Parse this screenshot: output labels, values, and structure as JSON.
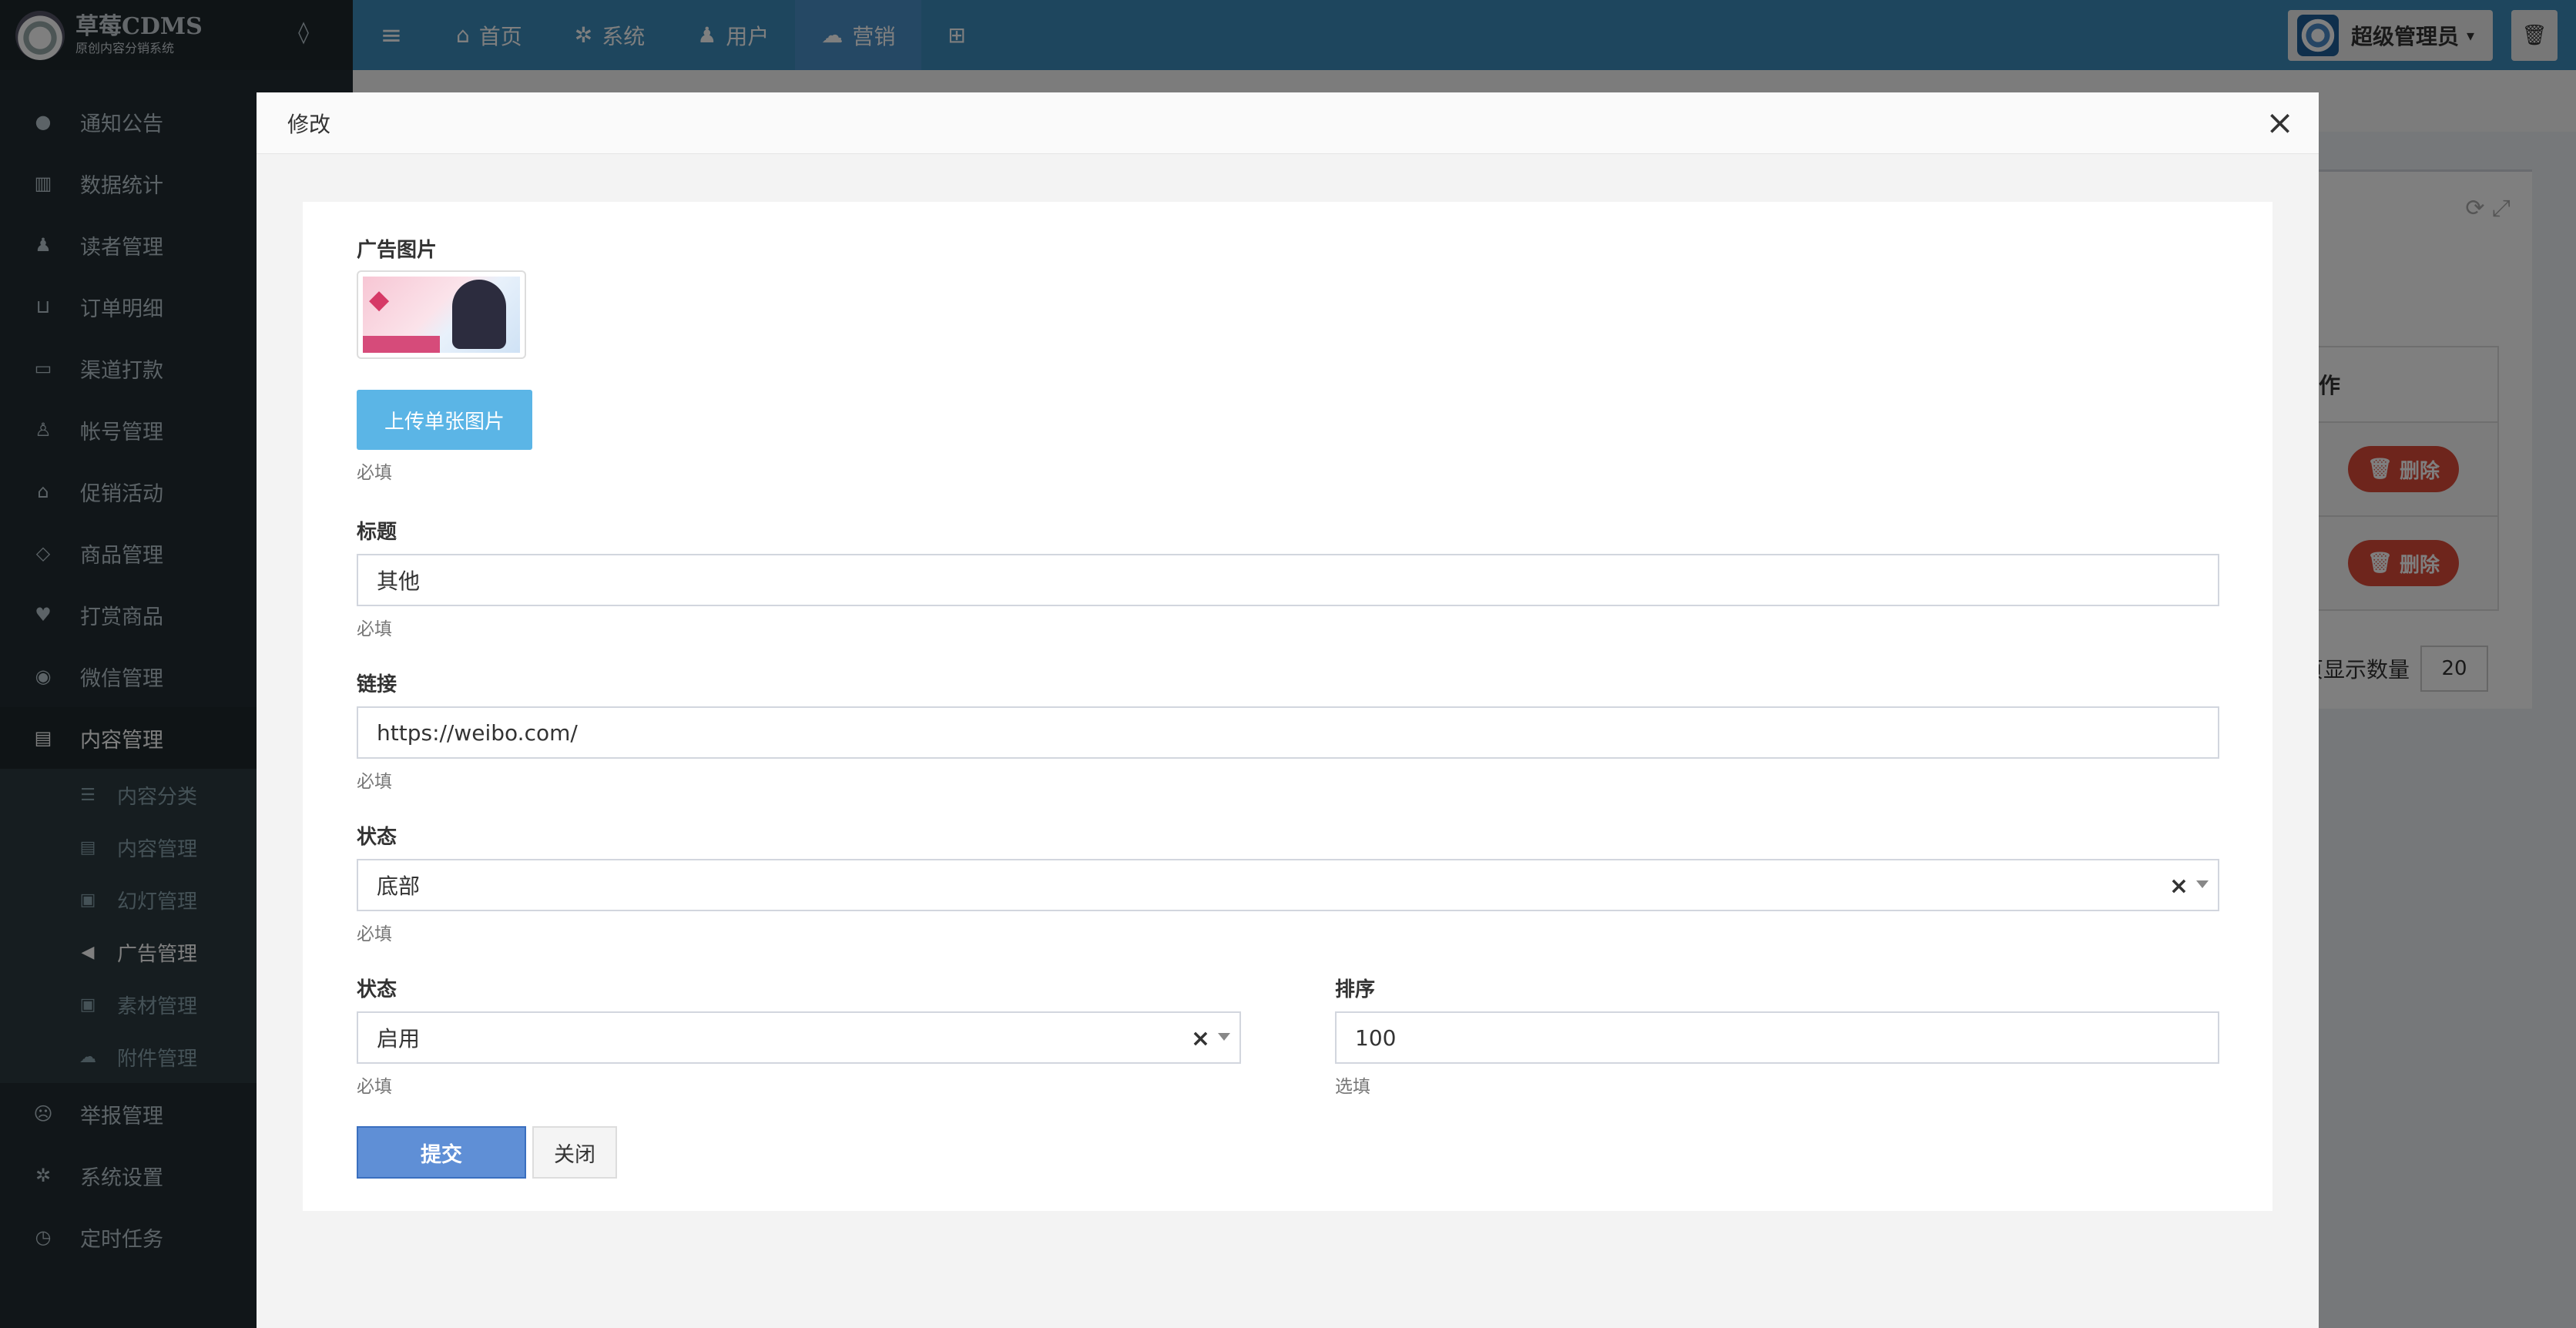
{
  "brand": {
    "title": "草莓CDMS",
    "subtitle": "原创内容分销系统"
  },
  "sidebar": {
    "items": [
      {
        "label": "通知公告",
        "icon": "comment-icon"
      },
      {
        "label": "数据统计",
        "icon": "bar-chart-icon"
      },
      {
        "label": "读者管理",
        "icon": "users-icon"
      },
      {
        "label": "订单明细",
        "icon": "cart-icon"
      },
      {
        "label": "渠道打款",
        "icon": "card-icon"
      },
      {
        "label": "帐号管理",
        "icon": "user-icon"
      },
      {
        "label": "促销活动",
        "icon": "bank-icon"
      },
      {
        "label": "商品管理",
        "icon": "diamond-icon"
      },
      {
        "label": "打赏商品",
        "icon": "heart-icon"
      },
      {
        "label": "微信管理",
        "icon": "wechat-icon"
      },
      {
        "label": "内容管理",
        "icon": "book-icon"
      }
    ],
    "subitems": [
      {
        "label": "内容分类",
        "icon": "list-icon"
      },
      {
        "label": "内容管理",
        "icon": "book-icon"
      },
      {
        "label": "幻灯管理",
        "icon": "image-icon"
      },
      {
        "label": "广告管理",
        "icon": "bullhorn-icon"
      },
      {
        "label": "素材管理",
        "icon": "image-icon"
      },
      {
        "label": "附件管理",
        "icon": "cloud-icon"
      }
    ],
    "items_after": [
      {
        "label": "举报管理",
        "icon": "frown-icon"
      },
      {
        "label": "系统设置",
        "icon": "gear-icon"
      },
      {
        "label": "定时任务",
        "icon": "clock-icon"
      }
    ]
  },
  "topnav": {
    "tabs": [
      {
        "label": "首页",
        "icon": "home-icon"
      },
      {
        "label": "系统",
        "icon": "gear-icon"
      },
      {
        "label": "用户",
        "icon": "user-icon"
      },
      {
        "label": "营销",
        "icon": "cloud-icon"
      }
    ],
    "user_name": "超级管理员"
  },
  "background": {
    "table_header": "操作",
    "delete_label": "删除",
    "page_size_label": "每页显示数量",
    "page_size_value": "20"
  },
  "modal": {
    "title": "修改",
    "image_label": "广告图片",
    "upload_label": "上传单张图片",
    "upload_help": "必填",
    "title_label": "标题",
    "title_value": "其他",
    "title_help": "必填",
    "link_label": "链接",
    "link_value": "https://weibo.com/",
    "link_help": "必填",
    "position_label": "状态",
    "position_value": "底部",
    "position_help": "必填",
    "status_label": "状态",
    "status_value": "启用",
    "status_help": "必填",
    "sort_label": "排序",
    "sort_value": "100",
    "sort_help": "选填",
    "submit_label": "提交",
    "close_label": "关闭"
  },
  "colors": {
    "sidebar_bg": "#222d32",
    "topnav_bg": "#3c8dbc",
    "primary": "#5f8fd6",
    "danger": "#dd4b39"
  }
}
